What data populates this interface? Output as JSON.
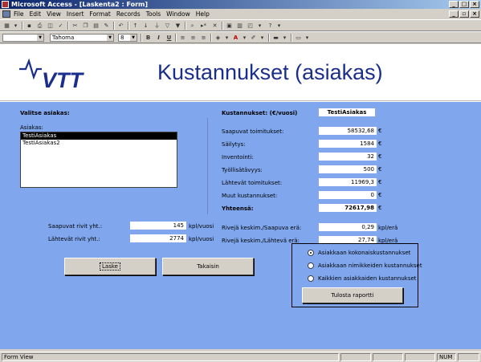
{
  "window": {
    "title": "Microsoft Access - [Laskenta2 : Form]"
  },
  "menu": [
    "File",
    "Edit",
    "View",
    "Insert",
    "Format",
    "Records",
    "Tools",
    "Window",
    "Help"
  ],
  "toolbar": {
    "font_name": "Tahoma",
    "font_size": "8"
  },
  "form": {
    "logo_text": "VTT",
    "title": "Kustannukset (asiakas)",
    "customer_section_label": "Valitse asiakas:",
    "customer_list_label": "Asiakas:",
    "customers": [
      "TestiAsiakas",
      "TestiAsiakas2"
    ],
    "costs_header_label": "Kustannukset: (€/vuosi)",
    "selected_customer": "TestiAsiakas",
    "currency": "€",
    "costs": [
      {
        "label": "Saapuvat toimitukset:",
        "value": "58532,68"
      },
      {
        "label": "Säilytys:",
        "value": "1584"
      },
      {
        "label": "Inventointi:",
        "value": "32"
      },
      {
        "label": "Työllisätävyys:",
        "value": "500"
      },
      {
        "label": "Lähtevät toimitukset:",
        "value": "11969,3"
      },
      {
        "label": "Muut kustannukset:",
        "value": "0"
      }
    ],
    "total": {
      "label": "Yhteensä:",
      "value": "72617,98"
    },
    "incoming_rows": {
      "label": "Saapuvat rivit yht.:",
      "value": "145",
      "unit": "kpl/vuosi"
    },
    "outgoing_rows": {
      "label": "Lähtevät rivit yht.:",
      "value": "2774",
      "unit": "kpl/vuosi"
    },
    "avg_incoming": {
      "label": "Rivejä keskim./Saapuva erä:",
      "value": "0,29",
      "unit": "kpl/erä"
    },
    "avg_outgoing": {
      "label": "Rivejä keskim./Lähtevä erä:",
      "value": "27,74",
      "unit": "kpl/erä"
    },
    "calculate_button": "Laske",
    "back_button": "Takaisin",
    "report_options": [
      {
        "label": "Asiakkaan kokonaiskustannukset",
        "selected": true
      },
      {
        "label": "Asiakkaan nimikkeiden kustannukset",
        "selected": false
      },
      {
        "label": "Kaikkien asiakkaiden kustannukset",
        "selected": false
      }
    ],
    "print_report_button": "Tulosta raportti"
  },
  "statusbar": {
    "view": "Form View",
    "num": "NUM"
  }
}
